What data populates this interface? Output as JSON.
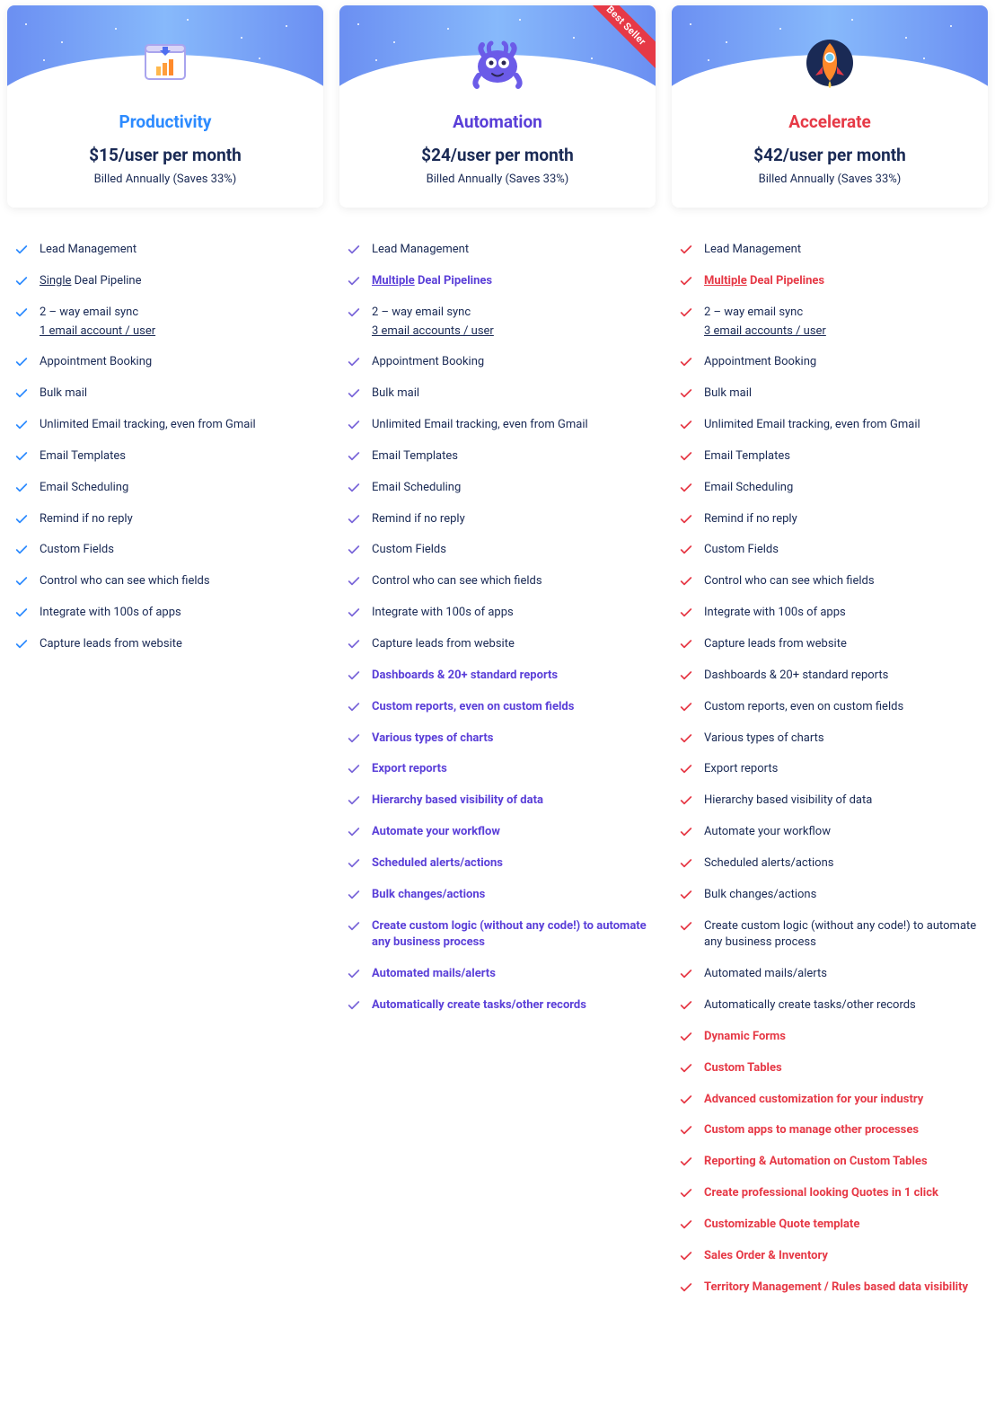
{
  "ribbon": "Best Seller",
  "plans": [
    {
      "id": "productivity",
      "name": "Productivity",
      "titleColor": "#2d8bff",
      "checkColor": "#2d8bff",
      "boldColor": "#2d8bff",
      "price": "$15/user per month",
      "billing": "Billed Annually (Saves 33%)",
      "ribbon": false,
      "features": [
        {
          "text": "Lead Management"
        },
        {
          "prefixUnderline": "Single",
          "suffix": " Deal Pipeline"
        },
        {
          "text": "2 – way email sync",
          "subUnderline": "1 email account / user"
        },
        {
          "text": "Appointment Booking"
        },
        {
          "text": "Bulk mail"
        },
        {
          "text": "Unlimited Email tracking, even from Gmail"
        },
        {
          "text": "Email Templates"
        },
        {
          "text": "Email Scheduling"
        },
        {
          "text": "Remind if no reply"
        },
        {
          "text": "Custom Fields"
        },
        {
          "text": "Control who can see which fields"
        },
        {
          "text": "Integrate with 100s of apps"
        },
        {
          "text": "Capture leads from website"
        }
      ]
    },
    {
      "id": "automation",
      "name": "Automation",
      "titleColor": "#5a3fd8",
      "checkColor": "#7a66d9",
      "boldColor": "#5a3fd8",
      "price": "$24/user per month",
      "billing": "Billed Annually (Saves 33%)",
      "ribbon": true,
      "features": [
        {
          "text": "Lead Management"
        },
        {
          "prefixUnderline": "Multiple",
          "suffix": " Deal Pipelines",
          "bold": true
        },
        {
          "text": "2 – way email sync",
          "subUnderline": "3 email accounts / user"
        },
        {
          "text": "Appointment Booking"
        },
        {
          "text": "Bulk mail"
        },
        {
          "text": "Unlimited Email tracking, even from Gmail"
        },
        {
          "text": "Email Templates"
        },
        {
          "text": "Email Scheduling"
        },
        {
          "text": "Remind if no reply"
        },
        {
          "text": "Custom Fields"
        },
        {
          "text": "Control who can see which fields"
        },
        {
          "text": "Integrate with 100s of apps"
        },
        {
          "text": "Capture leads from website"
        },
        {
          "text": "Dashboards & 20+ standard reports",
          "bold": true
        },
        {
          "text": "Custom reports, even on custom fields",
          "bold": true
        },
        {
          "text": "Various types of charts",
          "bold": true
        },
        {
          "text": "Export reports",
          "bold": true
        },
        {
          "text": "Hierarchy based visibility of data",
          "bold": true
        },
        {
          "text": "Automate your workflow",
          "bold": true
        },
        {
          "text": "Scheduled alerts/actions",
          "bold": true
        },
        {
          "text": "Bulk changes/actions",
          "bold": true
        },
        {
          "text": "Create custom logic (without any code!) to automate any business process",
          "bold": true
        },
        {
          "text": "Automated mails/alerts",
          "bold": true
        },
        {
          "text": "Automatically create tasks/other records",
          "bold": true
        }
      ]
    },
    {
      "id": "accelerate",
      "name": "Accelerate",
      "titleColor": "#e63946",
      "checkColor": "#e63946",
      "boldColor": "#e63946",
      "price": "$42/user per month",
      "billing": "Billed Annually (Saves 33%)",
      "ribbon": false,
      "features": [
        {
          "text": "Lead Management"
        },
        {
          "prefixUnderline": "Multiple",
          "suffix": " Deal Pipelines",
          "bold": true
        },
        {
          "text": "2 – way email sync",
          "subUnderline": "3 email accounts / user"
        },
        {
          "text": "Appointment Booking"
        },
        {
          "text": "Bulk mail"
        },
        {
          "text": "Unlimited Email tracking, even from Gmail"
        },
        {
          "text": "Email Templates"
        },
        {
          "text": "Email Scheduling"
        },
        {
          "text": "Remind if no reply"
        },
        {
          "text": "Custom Fields"
        },
        {
          "text": "Control who can see which fields"
        },
        {
          "text": "Integrate with 100s of apps"
        },
        {
          "text": "Capture leads from website"
        },
        {
          "text": "Dashboards & 20+ standard reports"
        },
        {
          "text": "Custom reports, even on custom fields"
        },
        {
          "text": "Various types of charts"
        },
        {
          "text": "Export reports"
        },
        {
          "text": "Hierarchy based visibility of data"
        },
        {
          "text": "Automate your workflow"
        },
        {
          "text": "Scheduled alerts/actions"
        },
        {
          "text": "Bulk changes/actions"
        },
        {
          "text": "Create custom logic (without any code!) to automate any business process"
        },
        {
          "text": "Automated mails/alerts"
        },
        {
          "text": "Automatically create tasks/other records"
        },
        {
          "text": "Dynamic Forms",
          "bold": true
        },
        {
          "text": "Custom Tables",
          "bold": true
        },
        {
          "text": "Advanced customization for your industry",
          "bold": true
        },
        {
          "text": "Custom apps to manage other processes",
          "bold": true
        },
        {
          "text": "Reporting & Automation on Custom Tables",
          "bold": true
        },
        {
          "text": "Create professional looking Quotes in 1 click",
          "bold": true
        },
        {
          "text": "Customizable Quote template",
          "bold": true
        },
        {
          "text": "Sales Order & Inventory",
          "bold": true
        },
        {
          "text": "Territory Management / Rules based data visibility",
          "bold": true
        }
      ]
    }
  ]
}
